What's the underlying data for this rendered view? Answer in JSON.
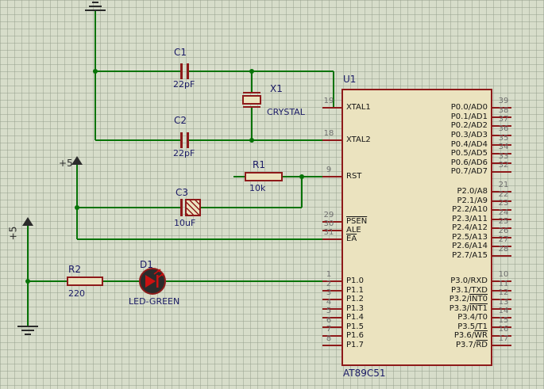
{
  "colors": {
    "wire": "#077307",
    "outline": "#8e1a1a",
    "chip_fill": "#ebe3bf",
    "background": "#d7ddca",
    "label": "#1a1a66",
    "pin_number": "#6e6e6e",
    "pin_name": "#141414",
    "terminal": "#2b2b2b",
    "led_body": "#2b2b2b",
    "led_symbol": "#cc1111"
  },
  "power": {
    "vcc_top": "+5",
    "vcc_left": "+5"
  },
  "components": {
    "c1": {
      "ref": "C1",
      "value": "22pF"
    },
    "c2": {
      "ref": "C2",
      "value": "22pF"
    },
    "c3": {
      "ref": "C3",
      "value": "10uF"
    },
    "x1": {
      "ref": "X1",
      "value": "CRYSTAL"
    },
    "r1": {
      "ref": "R1",
      "value": "10k"
    },
    "r2": {
      "ref": "R2",
      "value": "220"
    },
    "d1": {
      "ref": "D1",
      "value": "LED-GREEN"
    },
    "u1": {
      "ref": "U1",
      "part": "AT89C51"
    }
  },
  "chip": {
    "left_pins": [
      {
        "num": "19",
        "name": "XTAL1"
      },
      {
        "num": "18",
        "name": "XTAL2"
      },
      {
        "num": "9",
        "name": "RST"
      },
      {
        "num": "29",
        "name": "PSEN",
        "bar": "PSEN"
      },
      {
        "num": "30",
        "name": "ALE"
      },
      {
        "num": "31",
        "name": "EA",
        "bar": "EA"
      },
      {
        "num": "1",
        "name": "P1.0"
      },
      {
        "num": "2",
        "name": "P1.1"
      },
      {
        "num": "3",
        "name": "P1.2"
      },
      {
        "num": "4",
        "name": "P1.3"
      },
      {
        "num": "5",
        "name": "P1.4"
      },
      {
        "num": "6",
        "name": "P1.5"
      },
      {
        "num": "7",
        "name": "P1.6"
      },
      {
        "num": "8",
        "name": "P1.7"
      }
    ],
    "right_pins": [
      {
        "num": "39",
        "name": "P0.0/AD0"
      },
      {
        "num": "38",
        "name": "P0.1/AD1"
      },
      {
        "num": "37",
        "name": "P0.2/AD2"
      },
      {
        "num": "36",
        "name": "P0.3/AD3"
      },
      {
        "num": "35",
        "name": "P0.4/AD4"
      },
      {
        "num": "34",
        "name": "P0.5/AD5"
      },
      {
        "num": "33",
        "name": "P0.6/AD6"
      },
      {
        "num": "32",
        "name": "P0.7/AD7"
      },
      {
        "num": "21",
        "name": "P2.0/A8"
      },
      {
        "num": "22",
        "name": "P2.1/A9"
      },
      {
        "num": "23",
        "name": "P2.2/A10"
      },
      {
        "num": "24",
        "name": "P2.3/A11"
      },
      {
        "num": "25",
        "name": "P2.4/A12"
      },
      {
        "num": "26",
        "name": "P2.5/A13"
      },
      {
        "num": "27",
        "name": "P2.6/A14"
      },
      {
        "num": "28",
        "name": "P2.7/A15"
      },
      {
        "num": "10",
        "name": "P3.0/RXD"
      },
      {
        "num": "11",
        "name": "P3.1/TXD"
      },
      {
        "num": "12",
        "name": "P3.2/INT0",
        "bar": "INT0"
      },
      {
        "num": "13",
        "name": "P3.3/INT1",
        "bar": "INT1"
      },
      {
        "num": "14",
        "name": "P3.4/T0"
      },
      {
        "num": "15",
        "name": "P3.5/T1"
      },
      {
        "num": "16",
        "name": "P3.6/WR",
        "bar": "WR"
      },
      {
        "num": "17",
        "name": "P3.7/RD",
        "bar": "RD"
      }
    ]
  }
}
